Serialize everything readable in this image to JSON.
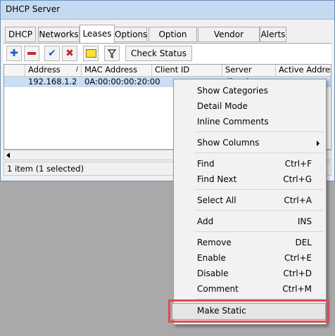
{
  "window": {
    "title": "DHCP Server"
  },
  "tabs": [
    "DHCP",
    "Networks",
    "Leases",
    "Options",
    "Option Sets",
    "Vendor Classes",
    "Alerts"
  ],
  "active_tab": "Leases",
  "toolbar": {
    "check_status": "Check Status"
  },
  "table": {
    "columns": [
      "Address",
      "MAC Address",
      "Client ID",
      "Server",
      "Active Address",
      "A"
    ],
    "rows": [
      {
        "address": "192.168.1.2",
        "mac": "0A:00:00:00:20:00",
        "client_id": "",
        "server": "dhcp1",
        "active_address": ""
      }
    ]
  },
  "status": "1 item (1 selected)",
  "context_menu": {
    "items": [
      {
        "label": "Show Categories",
        "shortcut": ""
      },
      {
        "label": "Detail Mode",
        "shortcut": ""
      },
      {
        "label": "Inline Comments",
        "shortcut": ""
      },
      {
        "label": "Show Columns",
        "shortcut": ""
      },
      {
        "label": "Find",
        "shortcut": "Ctrl+F"
      },
      {
        "label": "Find Next",
        "shortcut": "Ctrl+G"
      },
      {
        "label": "Select All",
        "shortcut": "Ctrl+A"
      },
      {
        "label": "Add",
        "shortcut": "INS"
      },
      {
        "label": "Remove",
        "shortcut": "DEL"
      },
      {
        "label": "Enable",
        "shortcut": "Ctrl+E"
      },
      {
        "label": "Disable",
        "shortcut": "Ctrl+D"
      },
      {
        "label": "Comment",
        "shortcut": "Ctrl+M"
      },
      {
        "label": "Make Static",
        "shortcut": ""
      }
    ]
  },
  "colors": {
    "highlight_border": "#e5474f",
    "selected_row": "#c9ddf4",
    "titlebar": "#c5daf1"
  }
}
